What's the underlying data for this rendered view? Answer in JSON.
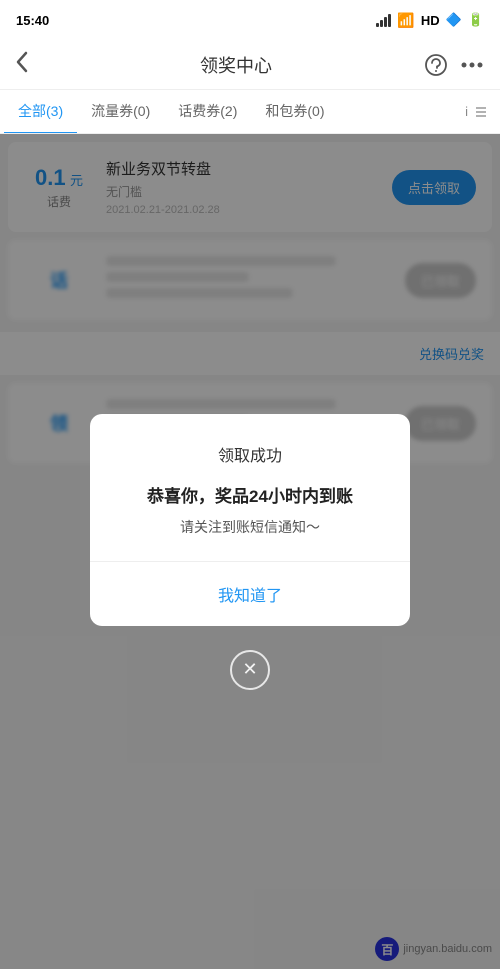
{
  "statusBar": {
    "time": "15:40",
    "signal": "HD",
    "batteryIcon": "🔋"
  },
  "header": {
    "backIcon": "‹",
    "title": "领奖中心",
    "serviceIcon": "service",
    "moreIcon": "more"
  },
  "tabs": [
    {
      "label": "全部(3)",
      "active": true
    },
    {
      "label": "流量券(0)",
      "active": false
    },
    {
      "label": "话费券(2)",
      "active": false
    },
    {
      "label": "和包券(0)",
      "active": false
    }
  ],
  "cards": [
    {
      "amount": "0.1",
      "unit": "元",
      "type": "话费",
      "title": "新业务双节转盘",
      "subtitle": "无门槛",
      "date": "2021.02.21-2021.02.28",
      "btnLabel": "点击领取",
      "btnActive": true
    },
    {
      "blurred": true,
      "amount": "话",
      "btnLabel": "已领取"
    },
    {
      "blurred": true,
      "amount": "领",
      "btnLabel": "兑换码兑奖"
    }
  ],
  "exchangeRow": {
    "label": "兑换码兑奖"
  },
  "dialog": {
    "title": "领取成功",
    "mainText": "恭喜你，奖品24小时内到账",
    "subText": "请关注到账短信通知～",
    "confirmLabel": "我知道了"
  },
  "closeBtn": "✕",
  "watermark": {
    "logo": "百",
    "text": "jingyan.baidu.com"
  }
}
